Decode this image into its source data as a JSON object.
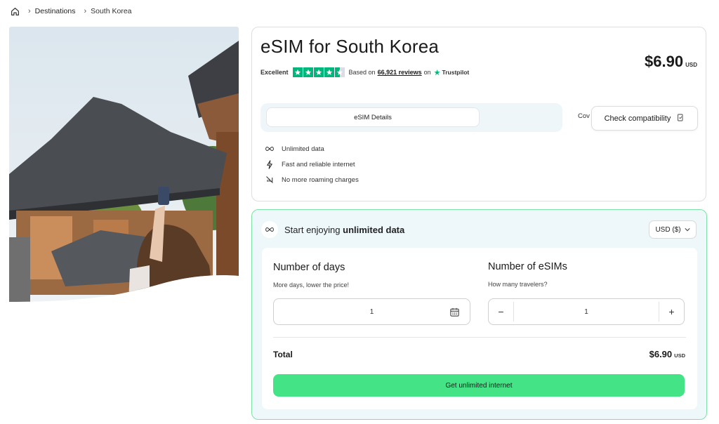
{
  "breadcrumb": {
    "home_icon": "home-icon",
    "items": [
      "Destinations",
      "South Korea"
    ]
  },
  "product": {
    "title": "eSIM for South Korea",
    "price": "$6.90",
    "currency": "USD",
    "rating": {
      "label": "Excellent",
      "stars": 4.5,
      "based_on": "Based on",
      "reviews": "66,921 reviews",
      "on": "on",
      "provider": "Trustpilot"
    },
    "tabs": [
      "eSIM Details",
      "Cov"
    ],
    "check_button": "Check compatibility",
    "features": [
      {
        "icon": "infinity-icon",
        "label": "Unlimited data"
      },
      {
        "icon": "lightning-icon",
        "label": "Fast and reliable internet"
      },
      {
        "icon": "no-roaming-icon",
        "label": "No more roaming charges"
      }
    ]
  },
  "purchase": {
    "heading_prefix": "Start enjoying",
    "heading_bold": "unlimited data",
    "currency_select": "USD ($)",
    "days": {
      "title": "Number of days",
      "subtitle": "More days, lower the price!",
      "value": "1"
    },
    "esims": {
      "title": "Number of eSIMs",
      "subtitle": "How many travelers?",
      "value": "1",
      "minus": "−",
      "plus": "+"
    },
    "total_label": "Total",
    "total_price": "$6.90",
    "total_currency": "USD",
    "cta": "Get unlimited internet"
  },
  "colors": {
    "accent_green": "#44e386",
    "trustpilot_green": "#00b67a",
    "card_border_green": "#7ee2a8",
    "tint_bg": "#eef8fb"
  }
}
